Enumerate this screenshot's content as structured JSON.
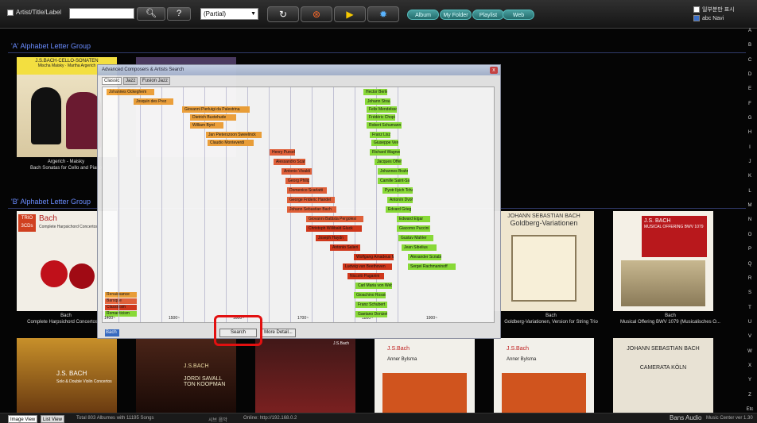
{
  "toolbar": {
    "artist_title_label": "Artist/Title/Label",
    "select_value": "(Partial)",
    "pills": [
      "Album",
      "My Folder",
      "Playlist",
      "Web"
    ],
    "right_option_1": "일부분만 표시",
    "right_option_2": "abc Navi",
    "question_label": "?"
  },
  "alphabet": [
    "A",
    "B",
    "C",
    "D",
    "E",
    "F",
    "G",
    "H",
    "I",
    "J",
    "K",
    "L",
    "M",
    "N",
    "O",
    "P",
    "Q",
    "R",
    "S",
    "T",
    "U",
    "V",
    "W",
    "X",
    "Y",
    "Z",
    "Etc"
  ],
  "groups": [
    {
      "label": "'A' Alphabet Letter Group"
    },
    {
      "label": "'B' Alphabet Letter Group"
    }
  ],
  "albums": {
    "row1": [
      {
        "caption_line1": "Argerich - Maisky",
        "caption_line2": "Bach Sonatas for Cello and Piano",
        "cover_title": "J.S.BACH·CELLO-SONATEN",
        "cover_artists": "Mischa Maisky · Martha Argerich"
      }
    ],
    "row2": [
      {
        "caption_line1": "Bach",
        "caption_line2": "Complete Harpsichord Concertos, Et",
        "cover_title": "Bach",
        "cover_sub": "Complete Harpsichord Concertos",
        "cover_badge": "TRIO 3CDs"
      },
      {
        "caption_line1": "Bach",
        "caption_line2": "Goldberg-Variationen, Version for String Trio",
        "cover_title": "JOHANN SEBASTIAN BACH",
        "cover_sub": "Goldberg-Variationen"
      },
      {
        "caption_line1": "Bach",
        "caption_line2": "Musical Offering BWV 1079 (Musicalisches O...",
        "cover_title": "J.S. BACH",
        "cover_sub": "MUSICAL OFFERING BWV 1079"
      }
    ],
    "row3": [
      {
        "cover_title": "J.S. BACH",
        "cover_sub": "Solo & Double Violin Concertos"
      },
      {
        "cover_title": "J.S.BACH",
        "cover_sub": "JORDI SAVALL TON KOOPMAN"
      },
      {
        "cover_title": "J.S.Bach",
        "cover_sub": ""
      },
      {
        "cover_title": "J.S.Bach",
        "cover_sub": "Anner Bylsma"
      },
      {
        "cover_title": "J.S.Bach",
        "cover_sub": "Anner Bylsma"
      },
      {
        "cover_title": "JOHANN SEBASTIAN BACH",
        "cover_sub": "CAMERATA KÖLN"
      }
    ]
  },
  "dialog": {
    "title": "Advanced Composers & Artists Search",
    "close_label": "x",
    "tabs": [
      "Classic",
      "Jazz",
      "Fusion Jazz"
    ],
    "eras": [
      "Renaissance",
      "Baroque",
      "Classicism",
      "Romanticism"
    ],
    "centuries": [
      "1400~",
      "1500~",
      "1600~",
      "1700~",
      "1800~",
      "1900~"
    ],
    "composers": [
      {
        "name": "Johannes Ockeghem",
        "era": "ren"
      },
      {
        "name": "Josquin des Prez",
        "era": "ren"
      },
      {
        "name": "Giovanni Pierluigi da Palestrina",
        "era": "ren"
      },
      {
        "name": "Dietrich Buxtehude",
        "era": "ren"
      },
      {
        "name": "William Byrd",
        "era": "ren"
      },
      {
        "name": "Jan Pieterszoon Sweelinck",
        "era": "ren"
      },
      {
        "name": "Claudio Monteverdi",
        "era": "ren"
      },
      {
        "name": "Henry Purcell",
        "era": "bar"
      },
      {
        "name": "Alessandro Scarlatti",
        "era": "bar"
      },
      {
        "name": "Antonio Vivaldi",
        "era": "bar"
      },
      {
        "name": "Georg Philipp",
        "era": "bar"
      },
      {
        "name": "Domenico Scarlatti",
        "era": "bar"
      },
      {
        "name": "George Frideric Handel",
        "era": "bar"
      },
      {
        "name": "Johann Sebastian Bach",
        "era": "bar"
      },
      {
        "name": "Giovanni Battista Pergolesi",
        "era": "bar"
      },
      {
        "name": "Christoph Willibald Gluck",
        "era": "cla"
      },
      {
        "name": "Joseph Haydn",
        "era": "cla"
      },
      {
        "name": "Antonio Salieri",
        "era": "cla"
      },
      {
        "name": "Wolfgang Amadeus Mozart",
        "era": "cla"
      },
      {
        "name": "Ludwig van Beethoven",
        "era": "cla"
      },
      {
        "name": "Niccolò Paganini",
        "era": "cla"
      },
      {
        "name": "Carl Maria von Weber",
        "era": "rom"
      },
      {
        "name": "Gioachino Rossini",
        "era": "rom"
      },
      {
        "name": "Franz Schubert",
        "era": "rom"
      },
      {
        "name": "Gaetano Donizetti",
        "era": "rom"
      },
      {
        "name": "Hector Berlioz",
        "era": "rom"
      },
      {
        "name": "Johann Strauss I",
        "era": "rom"
      },
      {
        "name": "Felix Mendelssohn",
        "era": "rom"
      },
      {
        "name": "Frédéric Chopin",
        "era": "rom"
      },
      {
        "name": "Robert Schumann",
        "era": "rom"
      },
      {
        "name": "Franz Liszt",
        "era": "rom"
      },
      {
        "name": "Giuseppe Verdi",
        "era": "rom"
      },
      {
        "name": "Richard Wagner",
        "era": "rom"
      },
      {
        "name": "Jacques Offenbach",
        "era": "rom"
      },
      {
        "name": "Johannes Brahms",
        "era": "rom"
      },
      {
        "name": "Camille Saint-Saëns",
        "era": "rom"
      },
      {
        "name": "Pyotr Ilyich Tchaikovsky",
        "era": "rom"
      },
      {
        "name": "Antonín Dvořák",
        "era": "rom"
      },
      {
        "name": "Edvard Grieg",
        "era": "rom"
      },
      {
        "name": "Edward Elgar",
        "era": "rom"
      },
      {
        "name": "Giacomo Puccini",
        "era": "rom"
      },
      {
        "name": "Gustav Mahler",
        "era": "rom"
      },
      {
        "name": "Jean Sibelius",
        "era": "rom"
      },
      {
        "name": "Alexander Scriabin",
        "era": "rom"
      },
      {
        "name": "Sergei Rachmaninoff",
        "era": "rom"
      }
    ],
    "field_value": "Bach",
    "search_label": "Search",
    "more_detail_label": "More Detail..."
  },
  "status": {
    "tab_image": "Image View",
    "tab_list": "List View",
    "summary": "Total 803 Albumes with 11195 Songs",
    "mode": "시브 음악",
    "online": "Online: http://192.168.0.2",
    "brand": "Bans Audio",
    "version": "Music Center ver 1.30"
  },
  "colors": {
    "renaissance": "#f2a43a",
    "baroque": "#e8643c",
    "classicism": "#d83a1c",
    "romanticism": "#8ee23a",
    "accent": "#6a8cff",
    "highlight": "#e21010"
  }
}
